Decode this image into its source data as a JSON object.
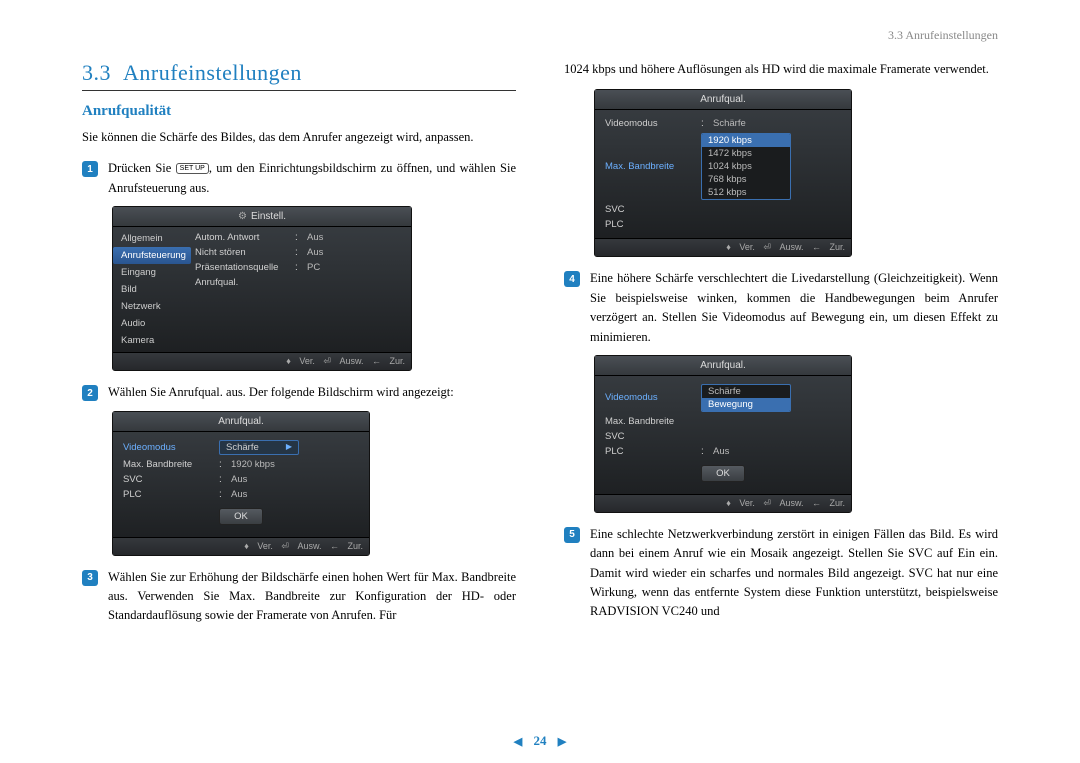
{
  "header": {
    "crumb": "3.3 Anrufeinstellungen"
  },
  "section": {
    "number": "3.3",
    "title": "Anrufeinstellungen"
  },
  "sub": {
    "title": "Anrufqualität"
  },
  "intro": "Sie können die Schärfe des Bildes, das dem Anrufer angezeigt wird, anpassen.",
  "steps": {
    "s1a": "Drücken Sie ",
    "s1key": "SET UP",
    "s1b": ", um den Einrichtungsbildschirm zu öffnen, und wählen Sie Anrufsteuerung aus.",
    "s2": "Wählen Sie Anrufqual. aus. Der folgende Bildschirm wird angezeigt:",
    "s3": "Wählen Sie zur Erhöhung der Bildschärfe einen hohen Wert für Max. Bandbreite aus. Verwenden Sie Max. Bandbreite zur Konfiguration der HD- oder Standardauflösung sowie der Framerate von Anrufen. Für",
    "s3cont": "1024 kbps und höhere Auflösungen als HD wird die maximale Framerate verwendet.",
    "s4": "Eine höhere Schärfe verschlechtert die Livedarstellung (Gleichzeitigkeit). Wenn Sie beispielsweise winken, kommen die Handbewegungen beim Anrufer verzögert an. Stellen Sie Videomodus auf Bewegung ein, um diesen Effekt zu minimieren.",
    "s5": "Eine schlechte Netzwerkverbindung zerstört in einigen Fällen das Bild. Es wird dann bei einem Anruf wie ein Mosaik angezeigt. Stellen Sie SVC auf Ein ein. Damit wird wieder ein scharfes und normales Bild angezeigt. SVC hat nur eine Wirkung, wenn das entfernte System diese Funktion unterstützt, beispielsweise RADVISION VC240 und"
  },
  "shot1": {
    "title": "Einstell.",
    "sidebar": [
      "Allgemein",
      "Anrufsteuerung",
      "Eingang",
      "Bild",
      "Netzwerk",
      "Audio",
      "Kamera"
    ],
    "rows": [
      {
        "label": "Autom. Antwort",
        "val": "Aus"
      },
      {
        "label": "Nicht stören",
        "val": "Aus"
      },
      {
        "label": "Präsentationsquelle",
        "val": "PC"
      },
      {
        "label": "Anrufqual.",
        "val": ""
      }
    ]
  },
  "shot2": {
    "title": "Anrufqual.",
    "rows": [
      {
        "label": "Videomodus",
        "val": "Schärfe",
        "sel": true
      },
      {
        "label": "Max. Bandbreite",
        "val": "1920 kbps"
      },
      {
        "label": "SVC",
        "val": "Aus"
      },
      {
        "label": "PLC",
        "val": "Aus"
      }
    ],
    "ok": "OK"
  },
  "shot3": {
    "title": "Anrufqual.",
    "rows": [
      {
        "label": "Videomodus",
        "val": "Schärfe"
      },
      {
        "label": "Max. Bandbreite",
        "opts": [
          "1920 kbps",
          "1472 kbps",
          "1024 kbps",
          "768 kbps",
          "512 kbps"
        ],
        "hi": 0
      },
      {
        "label": "SVC"
      },
      {
        "label": "PLC"
      }
    ]
  },
  "shot4": {
    "title": "Anrufqual.",
    "rows": [
      {
        "label": "Videomodus",
        "opts": [
          "Schärfe",
          "Bewegung"
        ],
        "hi": 1,
        "blue": true
      },
      {
        "label": "Max. Bandbreite"
      },
      {
        "label": "SVC",
        "val": ""
      },
      {
        "label": "PLC",
        "val": "Aus"
      }
    ],
    "ok": "OK"
  },
  "footer": {
    "ver": "Ver.",
    "ausw": "Ausw.",
    "zur": "Zur."
  },
  "pager": {
    "num": "24"
  },
  "chart_data": {
    "type": "table",
    "title": "Anrufqual. Einstellungen",
    "fields": [
      {
        "name": "Videomodus",
        "options": [
          "Schärfe",
          "Bewegung"
        ],
        "default": "Schärfe"
      },
      {
        "name": "Max. Bandbreite",
        "options_kbps": [
          1920,
          1472,
          1024,
          768,
          512
        ],
        "default": 1920
      },
      {
        "name": "SVC",
        "options": [
          "Ein",
          "Aus"
        ],
        "default": "Aus"
      },
      {
        "name": "PLC",
        "options": [
          "Ein",
          "Aus"
        ],
        "default": "Aus"
      }
    ]
  }
}
